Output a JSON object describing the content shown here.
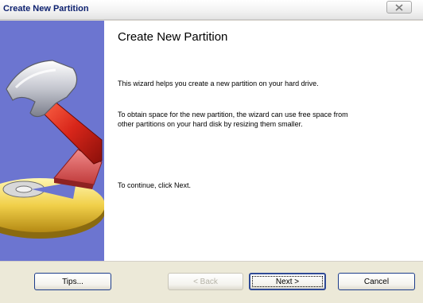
{
  "window": {
    "title": "Create New Partition",
    "close_icon": "close-x-icon"
  },
  "side_panel": {
    "background": "#6c75d0",
    "art": "hammer-and-disk-illustration"
  },
  "content": {
    "heading": "Create New Partition",
    "paragraph1": "This wizard helps you create a new partition on your hard drive.",
    "paragraph2": "To obtain space for the new partition, the wizard can use free space from other partitions on your hard disk by resizing them smaller.",
    "paragraph3": "To continue, click Next."
  },
  "buttons": {
    "tips": "Tips...",
    "back": "< Back",
    "back_enabled": false,
    "next": "Next >",
    "cancel": "Cancel"
  },
  "colors": {
    "dialog_face": "#ece9d8",
    "title_text": "#0b1f6e",
    "button_border": "#1c3c8a"
  }
}
